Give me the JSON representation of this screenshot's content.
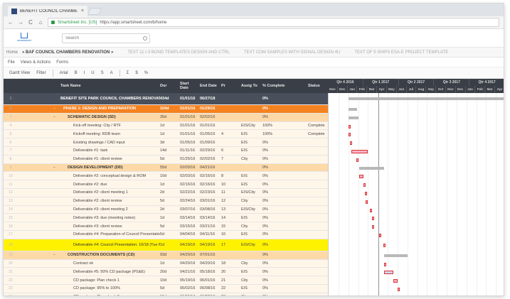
{
  "browser": {
    "tab_title": "BENEFIT COUNCIL CHAMBE",
    "tab_close": "×",
    "back": "←",
    "forward": "→",
    "reload": "C",
    "home": "⌂",
    "secure_label": "Smartsheet Inc. [US]",
    "url": "https://app.smartsheet.com/b/home"
  },
  "app": {
    "logo_text": "smartsheet",
    "search_placeholder": "Search"
  },
  "sheet_tabs": {
    "home": "Home",
    "active": "» BAF COUNCIL CHAMBERS RENOVATION »",
    "others": [
      "TEXT 11 I-3 BOND TEMPLATES DESIGN AND CTRL",
      "TEXT COM SAMPLES WITH SIGNAL DESIGN 4U",
      "TEXT OF 5 SHIPS ESA-E PROJECT TEMPLATE"
    ]
  },
  "menus": [
    "File",
    "Views & Actions",
    "Forms"
  ],
  "toolbar": {
    "items": [
      "Gantt View",
      "Filter",
      "Arial",
      "B",
      "I",
      "U",
      "S",
      "A",
      "Σ",
      "$",
      "%"
    ]
  },
  "columns": {
    "task_name": "Task Name",
    "duration": "Dur",
    "start": "Start Date",
    "end": "End Date",
    "predecessors": "Pr",
    "assigned": "Assig To",
    "complete": "% Complete",
    "status": "Status"
  },
  "gantt": {
    "quarters": [
      "Qtr 4 2016",
      "Qtr 1 2017",
      "Qtr 2 2017",
      "Qtr 3 2017",
      "Qtr 4 2017"
    ],
    "months": [
      "Nov",
      "Dec",
      "Jan",
      "Feb",
      "Mar",
      "Apr",
      "May",
      "Jun",
      "Jul",
      "Aug",
      "Sep",
      "Oct",
      "Nov",
      "Dec",
      "Jan",
      "Feb",
      "Mar",
      "Apr"
    ]
  },
  "rows": [
    {
      "num": "1",
      "level": 0,
      "name": "BENEFIT SITE PARK COUNCIL CHAMBERS RENOVATION",
      "duration": "434d",
      "start": "01/01/16",
      "end": "06/27/18",
      "pred": "",
      "assigned": "",
      "pct": "0%",
      "status": ""
    },
    {
      "num": "2",
      "level": 1,
      "name": "PHASE 1: DESIGN AND PREPARATION",
      "duration": "104d",
      "start": "01/01/16",
      "end": "01/29/16",
      "pred": "",
      "assigned": "",
      "pct": "0%",
      "status": ""
    },
    {
      "num": "3",
      "level": 2,
      "name": "SCHEMATIC DESIGN (SD)",
      "duration": "35d",
      "start": "01/01/16",
      "end": "02/02/16",
      "pred": "",
      "assigned": "",
      "pct": "0%",
      "status": ""
    },
    {
      "num": "4",
      "level": 3,
      "name": "Kick-off meeting: City / RTF",
      "duration": "1d",
      "start": "01/01/16",
      "end": "01/01/16",
      "pred": "",
      "assigned": "EIS/City",
      "pct": "100%",
      "status": "Complete"
    },
    {
      "num": "5",
      "level": 3,
      "name": "Kickoff meeting: RDB team",
      "duration": "1d",
      "start": "01/01/16",
      "end": "01/05/16",
      "pred": "4",
      "assigned": "EIS",
      "pct": "100%",
      "status": "Complete"
    },
    {
      "num": "6",
      "level": 3,
      "name": "Existing drawings / CAD input",
      "duration": "3d",
      "start": "01/05/16",
      "end": "01/09/16",
      "pred": "",
      "assigned": "EIS",
      "pct": "0%",
      "status": ""
    },
    {
      "num": "7",
      "level": 3,
      "name": "Deliverable #1: task",
      "duration": "14d",
      "start": "01/11/16",
      "end": "02/29/16",
      "pred": "6",
      "assigned": "EIS",
      "pct": "0%",
      "status": ""
    },
    {
      "num": "8",
      "level": 3,
      "name": "Deliverable #1: client review",
      "duration": "5d",
      "start": "01/25/16",
      "end": "02/02/16",
      "pred": "7",
      "assigned": "City",
      "pct": "0%",
      "status": ""
    },
    {
      "num": "9",
      "level": 2,
      "name": "DESIGN DEVELOPMENT (DD)",
      "duration": "55d",
      "start": "02/03/16",
      "end": "04/21/16",
      "pred": "",
      "assigned": "",
      "pct": "0%",
      "status": ""
    },
    {
      "num": "10",
      "level": 3,
      "name": "Deliverable #2: conceptual design & ROM",
      "duration": "10d",
      "start": "02/03/16",
      "end": "02/16/16",
      "pred": "8",
      "assigned": "EIS",
      "pct": "0%",
      "status": ""
    },
    {
      "num": "11",
      "level": 3,
      "name": "Deliverable #2: due",
      "duration": "1d",
      "start": "02/16/16",
      "end": "02/16/16",
      "pred": "10",
      "assigned": "EIS",
      "pct": "0%",
      "status": ""
    },
    {
      "num": "12",
      "level": 3,
      "name": "Deliverable #2: client meeting 1",
      "duration": "2d",
      "start": "02/22/16",
      "end": "02/23/16",
      "pred": "11",
      "assigned": "EIS/City",
      "pct": "0%",
      "status": ""
    },
    {
      "num": "13",
      "level": 3,
      "name": "Deliverable #2: client review",
      "duration": "5d",
      "start": "02/24/16",
      "end": "03/01/16",
      "pred": "12",
      "assigned": "City",
      "pct": "0%",
      "status": ""
    },
    {
      "num": "14",
      "level": 3,
      "name": "Deliverable #3: client meeting 2",
      "duration": "2d",
      "start": "03/07/16",
      "end": "03/08/16",
      "pred": "13",
      "assigned": "EIS/City",
      "pct": "0%",
      "status": ""
    },
    {
      "num": "15",
      "level": 3,
      "name": "Deliverable #3: due (meeting notes)",
      "duration": "1d",
      "start": "03/14/16",
      "end": "03/14/16",
      "pred": "14",
      "assigned": "EIS",
      "pct": "0%",
      "status": ""
    },
    {
      "num": "16",
      "level": 3,
      "name": "Deliverable #3: client review",
      "duration": "5d",
      "start": "03/15/16",
      "end": "03/21/16",
      "pred": "15",
      "assigned": "City",
      "pct": "0%",
      "status": ""
    },
    {
      "num": "17",
      "level": 3,
      "name": "Deliverable #4: Preparation of Council Presentation",
      "duration": "5d",
      "start": "04/04/16",
      "end": "04/11/16",
      "pred": "16",
      "assigned": "EIS",
      "pct": "0%",
      "status": ""
    },
    {
      "num": "18",
      "level": 4,
      "name": "Deliverable #4: Council Presentation: 10/18 (Tue Mtg - Renewed)",
      "duration": "1d",
      "start": "04/19/16",
      "end": "04/19/16",
      "pred": "17",
      "assigned": "EIS/City",
      "pct": "0%",
      "status": ""
    },
    {
      "num": "19",
      "level": 2,
      "name": "CONSTRUCTION DOCUMENTS (CD)",
      "duration": "93d",
      "start": "04/20/16",
      "end": "07/01/16",
      "pred": "",
      "assigned": "",
      "pct": "0%",
      "status": ""
    },
    {
      "num": "20",
      "level": 3,
      "name": "Contract ok",
      "duration": "1d",
      "start": "04/20/16",
      "end": "04/20/16",
      "pred": "18",
      "assigned": "City",
      "pct": "0%",
      "status": ""
    },
    {
      "num": "21",
      "level": 3,
      "name": "Deliverable #5: 50% CD package (PS&E)",
      "duration": "20d",
      "start": "04/21/16",
      "end": "05/18/16",
      "pred": "20",
      "assigned": "EIS",
      "pct": "0%",
      "status": ""
    },
    {
      "num": "22",
      "level": 3,
      "name": "CD package: Plan check 1",
      "duration": "10d",
      "start": "05/19/16",
      "end": "06/01/16",
      "pred": "21",
      "assigned": "City",
      "pct": "0%",
      "status": ""
    },
    {
      "num": "23",
      "level": 3,
      "name": "CD package: 95% to 100%",
      "duration": "5d",
      "start": "06/02/16",
      "end": "06/08/16",
      "pred": "22",
      "assigned": "EIS",
      "pct": "0%",
      "status": ""
    },
    {
      "num": "24",
      "level": 3,
      "name": "CD package: Plan check 2",
      "duration": "10d",
      "start": "06/09/16",
      "end": "06/22/16",
      "pred": "23",
      "assigned": "City",
      "pct": "0%",
      "status": ""
    }
  ]
}
